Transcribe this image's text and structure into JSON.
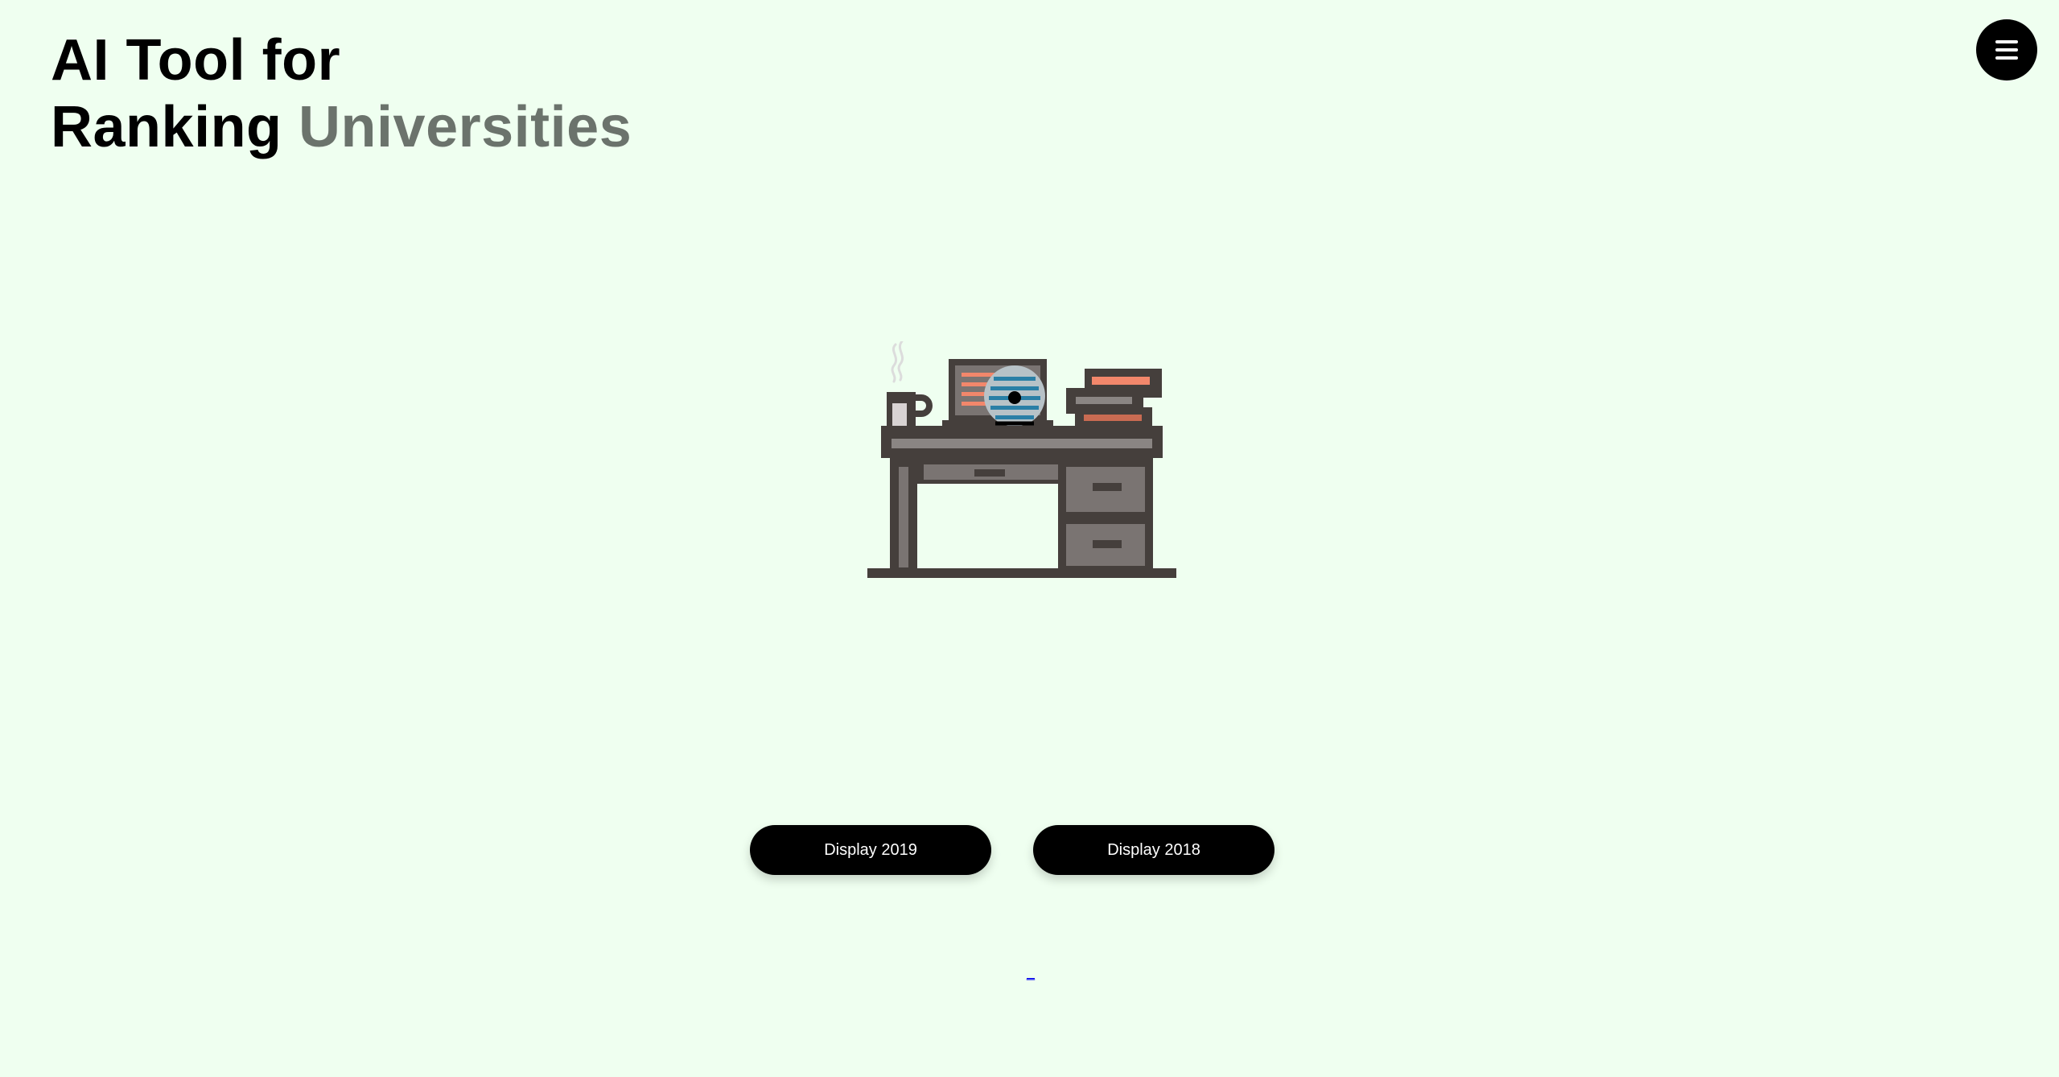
{
  "header": {
    "title_line1": "AI Tool for",
    "title_line2_primary": "Ranking",
    "title_line2_secondary": "Universities"
  },
  "menu": {
    "icon": "hamburger-menu-icon"
  },
  "illustration": {
    "icon": "office-desk-with-computer-coffee-mug-and-books",
    "colors": {
      "outline": "#453f3c",
      "desk_top": "#8a8583",
      "drawer": "#7a7472",
      "paper_accent": "#f2876b",
      "screen_lines": "#2a7fa6",
      "mug": "#d8d3d3"
    }
  },
  "actions": {
    "display_2019_label": "Display 2019",
    "display_2018_label": "Display 2018"
  },
  "footer": {
    "link_text": "_"
  },
  "theme": {
    "background": "#effff0",
    "accent_muted": "#6b736c",
    "button_bg": "#000000",
    "button_text": "#ffffff"
  }
}
